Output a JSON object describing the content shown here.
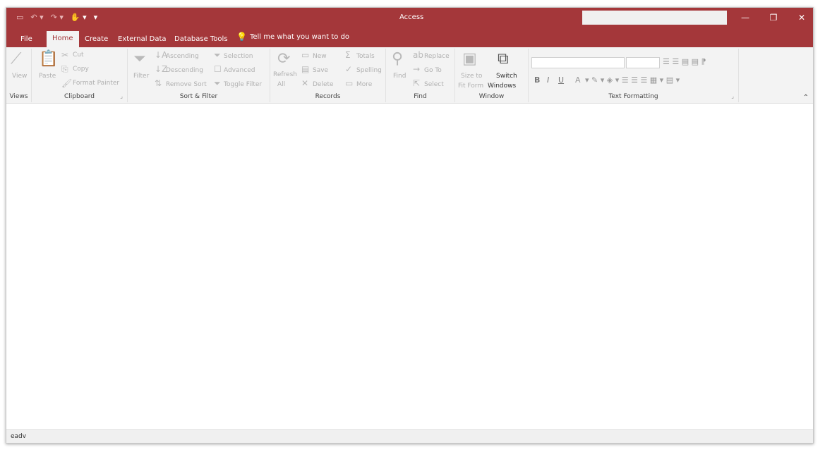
{
  "window": {
    "title": "Access",
    "minimize_glyph": "—",
    "restore_glyph": "❐",
    "close_glyph": "✕"
  },
  "quick_access": [
    "save-icon",
    "undo-icon",
    "redo-icon",
    "touch-mode-icon",
    "customize-qat-icon"
  ],
  "tabs": {
    "file": "File",
    "home": "Home",
    "create": "Create",
    "external": "External Data",
    "dbtools": "Database Tools"
  },
  "tell_me": "Tell me what you want to do",
  "ribbon": {
    "views": {
      "label": "Views",
      "view": "View"
    },
    "clipboard": {
      "label": "Clipboard",
      "paste": "Paste",
      "cut": "Cut",
      "copy": "Copy",
      "format_painter": "Format Painter"
    },
    "sort_filter": {
      "label": "Sort & Filter",
      "filter": "Filter",
      "ascending": "Ascending",
      "descending": "Descending",
      "remove_sort": "Remove Sort",
      "selection": "Selection",
      "advanced": "Advanced",
      "toggle_filter": "Toggle Filter"
    },
    "records": {
      "label": "Records",
      "refresh": "Refresh",
      "refresh_all": "All",
      "new": "New",
      "save": "Save",
      "delete": "Delete",
      "totals": "Totals",
      "spelling": "Spelling",
      "more": "More"
    },
    "find": {
      "label": "Find",
      "find": "Find",
      "replace": "Replace",
      "goto": "Go To",
      "select": "Select"
    },
    "window": {
      "label": "Window",
      "size_to": "Size to",
      "fit_form": "Fit Form",
      "switch": "Switch",
      "windows": "Windows"
    },
    "text_formatting": {
      "label": "Text Formatting",
      "bold": "B",
      "italic": "I",
      "underline": "U",
      "font_color": "A"
    }
  },
  "status": {
    "text": "eadv"
  }
}
